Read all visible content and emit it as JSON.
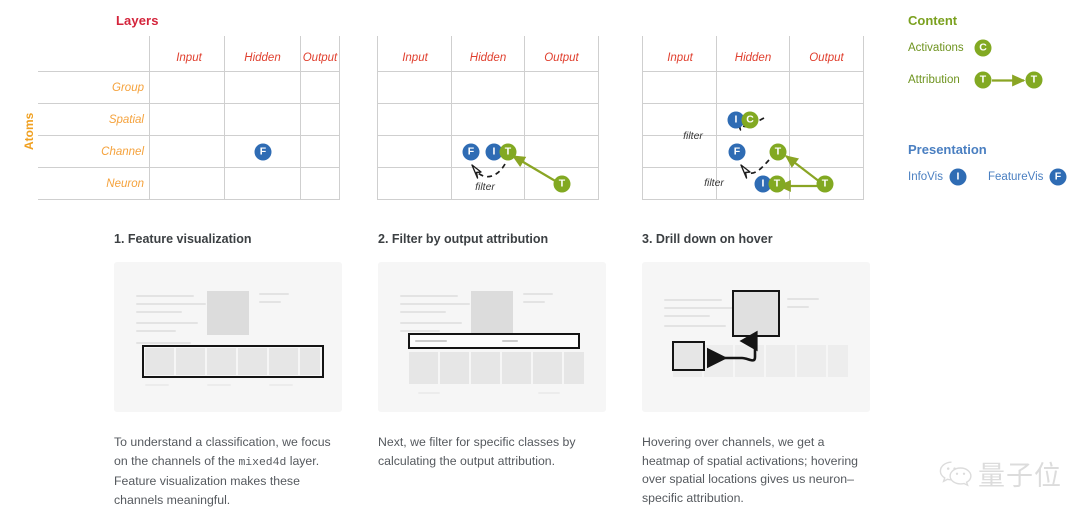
{
  "matrix": {
    "column_axis_title": "Layers",
    "row_axis_title": "Atoms",
    "columns": [
      "Input",
      "Hidden",
      "Output"
    ],
    "rows": [
      "Group",
      "Spatial",
      "Channel",
      "Neuron"
    ],
    "filter_label": "filter",
    "panels": [
      {
        "id": "matrix-1",
        "show_headers": true,
        "nodes": [
          {
            "label": "F",
            "color": "blue",
            "col": 1,
            "row": 2
          }
        ]
      },
      {
        "id": "matrix-2",
        "show_headers": true,
        "nodes": [
          {
            "label": "F",
            "color": "blue",
            "col": 1,
            "row": 2
          },
          {
            "label": "I",
            "color": "blue",
            "col": 1,
            "row": 2
          },
          {
            "label": "T",
            "color": "green",
            "col": 1,
            "row": 2
          },
          {
            "label": "T",
            "color": "green",
            "col": 2,
            "row": 3
          }
        ],
        "filters": [
          "filter"
        ]
      },
      {
        "id": "matrix-3",
        "show_headers": true,
        "nodes": [
          {
            "label": "I",
            "color": "blue",
            "col": 1,
            "row": 1
          },
          {
            "label": "C",
            "color": "green",
            "col": 1,
            "row": 1
          },
          {
            "label": "F",
            "color": "blue",
            "col": 1,
            "row": 2
          },
          {
            "label": "T",
            "color": "green",
            "col": 2,
            "row": 2
          },
          {
            "label": "I",
            "color": "blue",
            "col": 1,
            "row": 3
          },
          {
            "label": "T",
            "color": "green",
            "col": 1,
            "row": 3
          },
          {
            "label": "T",
            "color": "green",
            "col": 2,
            "row": 3
          }
        ],
        "filters": [
          "filter",
          "filter"
        ]
      }
    ]
  },
  "legend": {
    "content": {
      "heading": "Content",
      "items": [
        {
          "label": "Activations",
          "glyphs": [
            "C"
          ],
          "color": "green"
        },
        {
          "label": "Attribution",
          "glyphs": [
            "T",
            "T"
          ],
          "color": "green"
        }
      ]
    },
    "presentation": {
      "heading": "Presentation",
      "items": [
        {
          "label": "InfoVis",
          "glyph": "I",
          "color": "blue"
        },
        {
          "label": "FeatureVis",
          "glyph": "F",
          "color": "blue"
        }
      ]
    }
  },
  "steps": [
    {
      "heading": "1. Feature visualization",
      "caption_before": "To understand a classification, we focus on the channels of the ",
      "caption_code": "mixed4d",
      "caption_after": " layer. Feature visualization makes these channels meaningful."
    },
    {
      "heading": "2. Filter by output attribution",
      "caption": "Next, we filter for specific classes by calculating the output attribution."
    },
    {
      "heading": "3. Drill down on hover",
      "caption": "Hovering over channels, we get a heatmap of spatial activations; hovering over spatial locations gives us neuron–specific attribution."
    }
  ],
  "watermark": {
    "icon": "wechat-icon",
    "text": "量子位"
  },
  "colors": {
    "red": "#d4243b",
    "column_header": "#e0402f",
    "row_header": "#f5a23c",
    "orange": "#f0a020",
    "green": "#82a922",
    "blue": "#2f6cb4",
    "legend_green": "#7ba11f",
    "legend_blue": "#4a7fc1",
    "grid": "#cfcfcf",
    "thumb_bg": "#f6f6f6",
    "text": "#55595e"
  }
}
